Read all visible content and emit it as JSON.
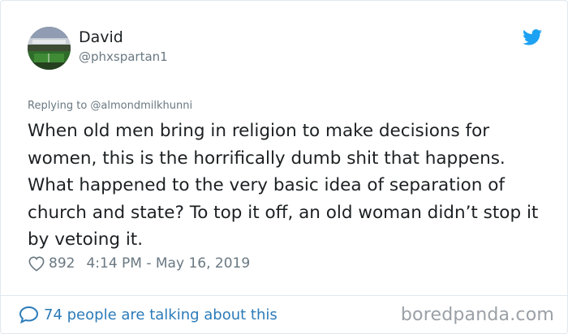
{
  "user": {
    "name": "David",
    "handle": "@phxspartan1"
  },
  "tweet": {
    "replying_to": "Replying to @almondmilkhunni",
    "text": "When old men bring in religion to make decisions for women, this is the horrifically dumb shit that happens. What happened to the very basic idea of separation of church and state? To top it off, an old woman didn’t stop it by vetoing it.",
    "likes": "892",
    "timestamp": "4:14 PM - May 16, 2019"
  },
  "footer": {
    "talking": "74 people are talking about this",
    "watermark": "boredpanda.com"
  },
  "icons": {
    "logo": "twitter-bird-icon",
    "like": "heart-icon",
    "reply": "speech-bubble-icon"
  },
  "colors": {
    "twitter_blue": "#1da1f2",
    "link_blue": "#2b7bb9",
    "secondary_text": "#697882",
    "primary_text": "#1c2022"
  }
}
